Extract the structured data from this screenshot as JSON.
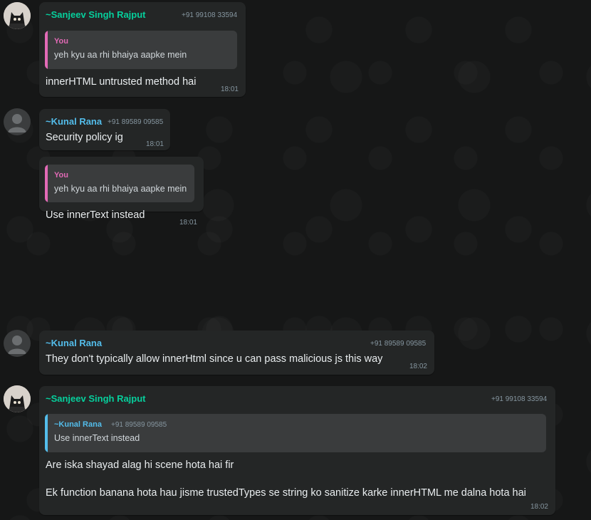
{
  "colors": {
    "background": "#161717",
    "bubble": "#242626",
    "quote": "#3a3c3d",
    "sender_green": "#06cf9c",
    "sender_blue": "#53bdeb",
    "you_pink": "#e26ab6"
  },
  "messages": [
    {
      "sender": "~Sanjeev Singh Rajput",
      "phone": "+91 99108 33594",
      "avatar_icon": "cat-photo-avatar",
      "quote": {
        "author": "You",
        "text": "yeh kyu aa rhi bhaiya aapke mein"
      },
      "text": "innerHTML untrusted method hai",
      "time": "18:01"
    },
    {
      "sender": "~Kunal Rana",
      "phone": "+91 89589 09585",
      "avatar_icon": "default-person-avatar",
      "text": "Security policy ig",
      "time": "18:01"
    },
    {
      "quote": {
        "author": "You",
        "text": "yeh kyu aa rhi bhaiya aapke mein"
      },
      "text": "Use innerText instead",
      "time": "18:01"
    },
    {
      "sender": "~Kunal Rana",
      "phone": "+91 89589 09585",
      "avatar_icon": "default-person-avatar",
      "text": "They don't typically allow innerHtml since u can pass malicious js this way",
      "time": "18:02"
    },
    {
      "sender": "~Sanjeev Singh Rajput",
      "phone": "+91 99108 33594",
      "avatar_icon": "cat-photo-avatar",
      "quote": {
        "author": "~Kunal Rana",
        "phone": "+91 89589 09585",
        "text": "Use innerText instead"
      },
      "text": "Are iska shayad alag hi scene hota hai fir",
      "text2": "Ek function banana hota hau jisme trustedTypes se string ko sanitize karke innerHTML me dalna hota hai",
      "time": "18:02"
    }
  ]
}
